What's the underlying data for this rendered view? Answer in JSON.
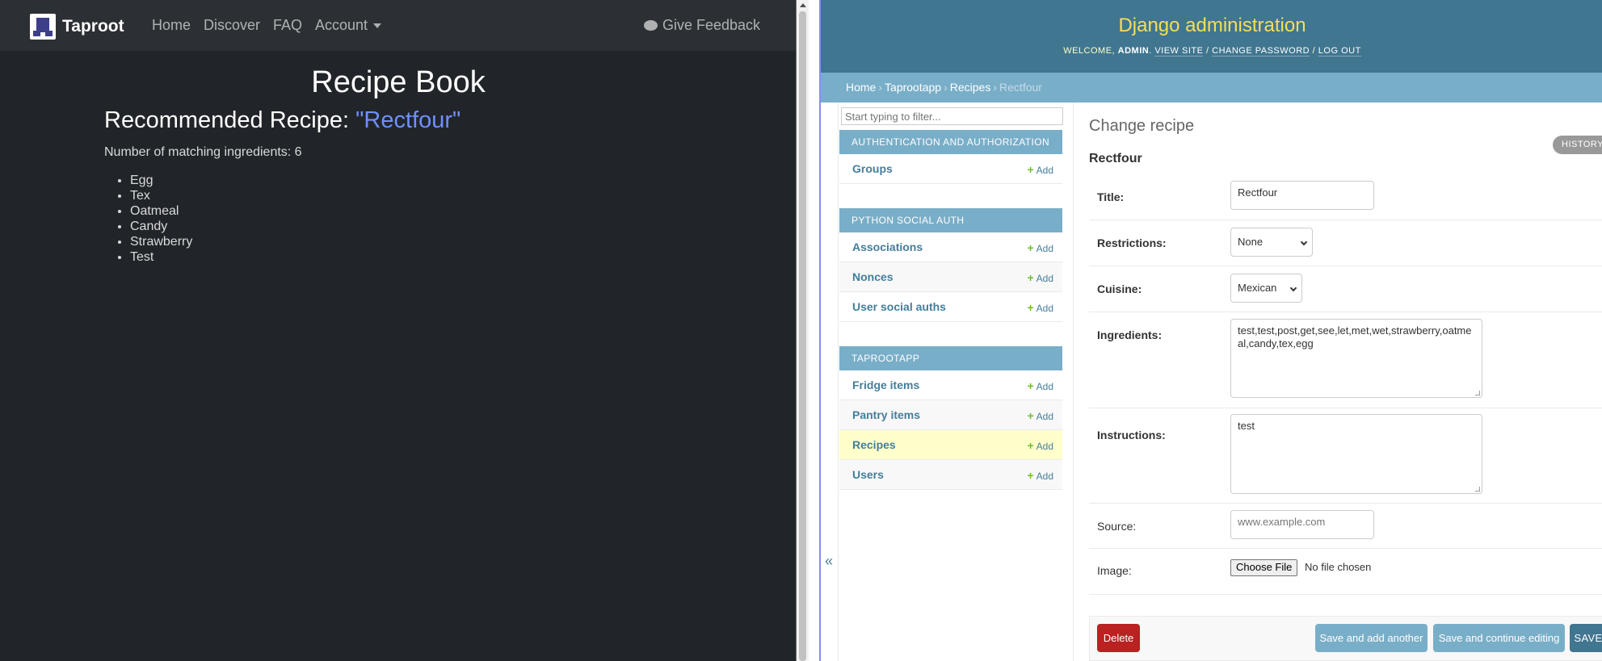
{
  "taproot": {
    "brand": "Taproot",
    "nav": {
      "home": "Home",
      "discover": "Discover",
      "faq": "FAQ",
      "account": "Account",
      "feedback": "Give Feedback"
    },
    "page_title": "Recipe Book",
    "recommend_prefix": "Recommended Recipe: ",
    "recipe_name": "\"Rectfour\"",
    "match_count": "Number of matching ingredients: 6",
    "ingredients": [
      "Egg",
      "Tex",
      "Oatmeal",
      "Candy",
      "Strawberry",
      "Test"
    ],
    "icons": {
      "logo": "taproot-logo-icon",
      "feedback": "comments-icon",
      "account": "caret-down-icon"
    }
  },
  "admin": {
    "site_title": "Django administration",
    "tools": {
      "welcome": "Welcome, ",
      "user": "admin",
      "period": ". ",
      "view_site": "View site",
      "sep": " / ",
      "change_password": "Change password",
      "logout": "Log out"
    },
    "breadcrumbs": {
      "home": "Home",
      "app": "Taprootapp",
      "model": "Recipes",
      "current": "Rectfour",
      "sep": "›"
    },
    "filter_placeholder": "Start typing to filter...",
    "add_label": "Add",
    "apps": [
      {
        "name": "Authentication and Authorization",
        "models": [
          "Groups"
        ]
      },
      {
        "name": "Python Social Auth",
        "models": [
          "Associations",
          "Nonces",
          "User social auths"
        ]
      },
      {
        "name": "Taprootapp",
        "models": [
          "Fridge items",
          "Pantry items",
          "Recipes",
          "Users"
        ]
      }
    ],
    "collapse_icon": "«",
    "page_title": "Change recipe",
    "history": "History",
    "object_name": "Rectfour",
    "fields": {
      "title": {
        "label": "Title:",
        "value": "Rectfour"
      },
      "restrictions": {
        "label": "Restrictions:",
        "value": "None"
      },
      "cuisine": {
        "label": "Cuisine:",
        "value": "Mexican"
      },
      "ingredients": {
        "label": "Ingredients:",
        "value": "test,test,post,get,see,let,met,wet,strawberry,oatmeal,candy,tex,egg"
      },
      "instructions": {
        "label": "Instructions:",
        "value": "test"
      },
      "source": {
        "label": "Source:",
        "placeholder": "www.example.com"
      },
      "image": {
        "label": "Image:",
        "button": "Choose File",
        "status": "No file chosen"
      }
    },
    "actions": {
      "delete": "Delete",
      "save_add": "Save and add another",
      "save_continue": "Save and continue editing",
      "save": "SAVE"
    },
    "colors": {
      "header": "#417690",
      "title": "#f5dd5d",
      "caption": "#79aec8",
      "delete": "#ba2121",
      "current_row": "#ffffcc"
    }
  }
}
